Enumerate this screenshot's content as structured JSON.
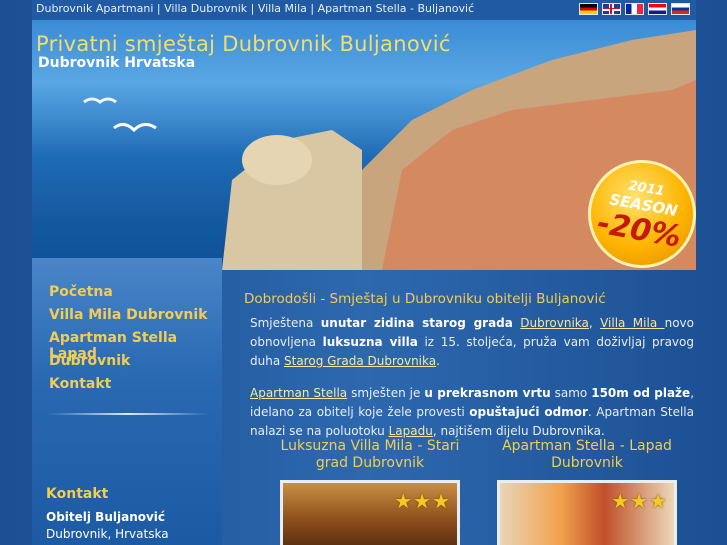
{
  "topbar": {
    "links": "Dubrovnik Apartmani | Villa Dubrovnik | Villa Mila | Apartman Stella - Buljanović"
  },
  "languages": [
    "de",
    "en",
    "fr",
    "hr",
    "ru"
  ],
  "header": {
    "title": "Privatni smještaj Dubrovnik Buljanović",
    "subtitle": "Dubrovnik Hrvatska",
    "badge_year": "2011",
    "badge_word": "SEASON",
    "badge_discount": "-20%"
  },
  "nav": {
    "items": [
      "Početna",
      "Villa Mila Dubrovnik",
      "Apartman Stella Lapad",
      "Dubrovnik",
      "Kontakt"
    ]
  },
  "contact": {
    "heading": "Kontakt",
    "name": "Obitelj Buljanović",
    "city": "Dubrovnik, Hrvatska"
  },
  "main": {
    "heading": "Dobrodošli - Smještaj u Dubrovniku obitelji Buljanović",
    "p1": {
      "t1": "Smještena ",
      "b1": "unutar zidina starog grada",
      "t2": " ",
      "l1": "Dubrovnika",
      "t3": ", ",
      "l2": "Villa Mila ",
      "t4": "novo obnovljena ",
      "b2": "luksuzna villa",
      "t5": " iz 15. stoljeća, pruža vam doživljaj pravog duha ",
      "l3": "Starog Grada Dubrovnika",
      "t6": "."
    },
    "p2": {
      "l1": "Apartman Stella",
      "t1": " smješten je ",
      "b1": "u prekrasnom vrtu",
      "t2": " samo ",
      "b2": "150m od plaže",
      "t3": ", idelano za obitelj koje žele provesti ",
      "b3": "opuštajući odmor",
      "t4": ". Apartman Stella nalazi se na poluotoku ",
      "l2": "Lapadu",
      "t5": ", najtišem dijelu Dubrovnika."
    },
    "cards": [
      {
        "title": "Luksuzna Villa Mila - Stari grad Dubrovnik",
        "stars": "★★★"
      },
      {
        "title": "Apartman Stella - Lapad Dubrovnik",
        "stars": "★★★"
      }
    ]
  },
  "colors": {
    "accent": "#f2cd52",
    "background": "#2d68ae"
  }
}
